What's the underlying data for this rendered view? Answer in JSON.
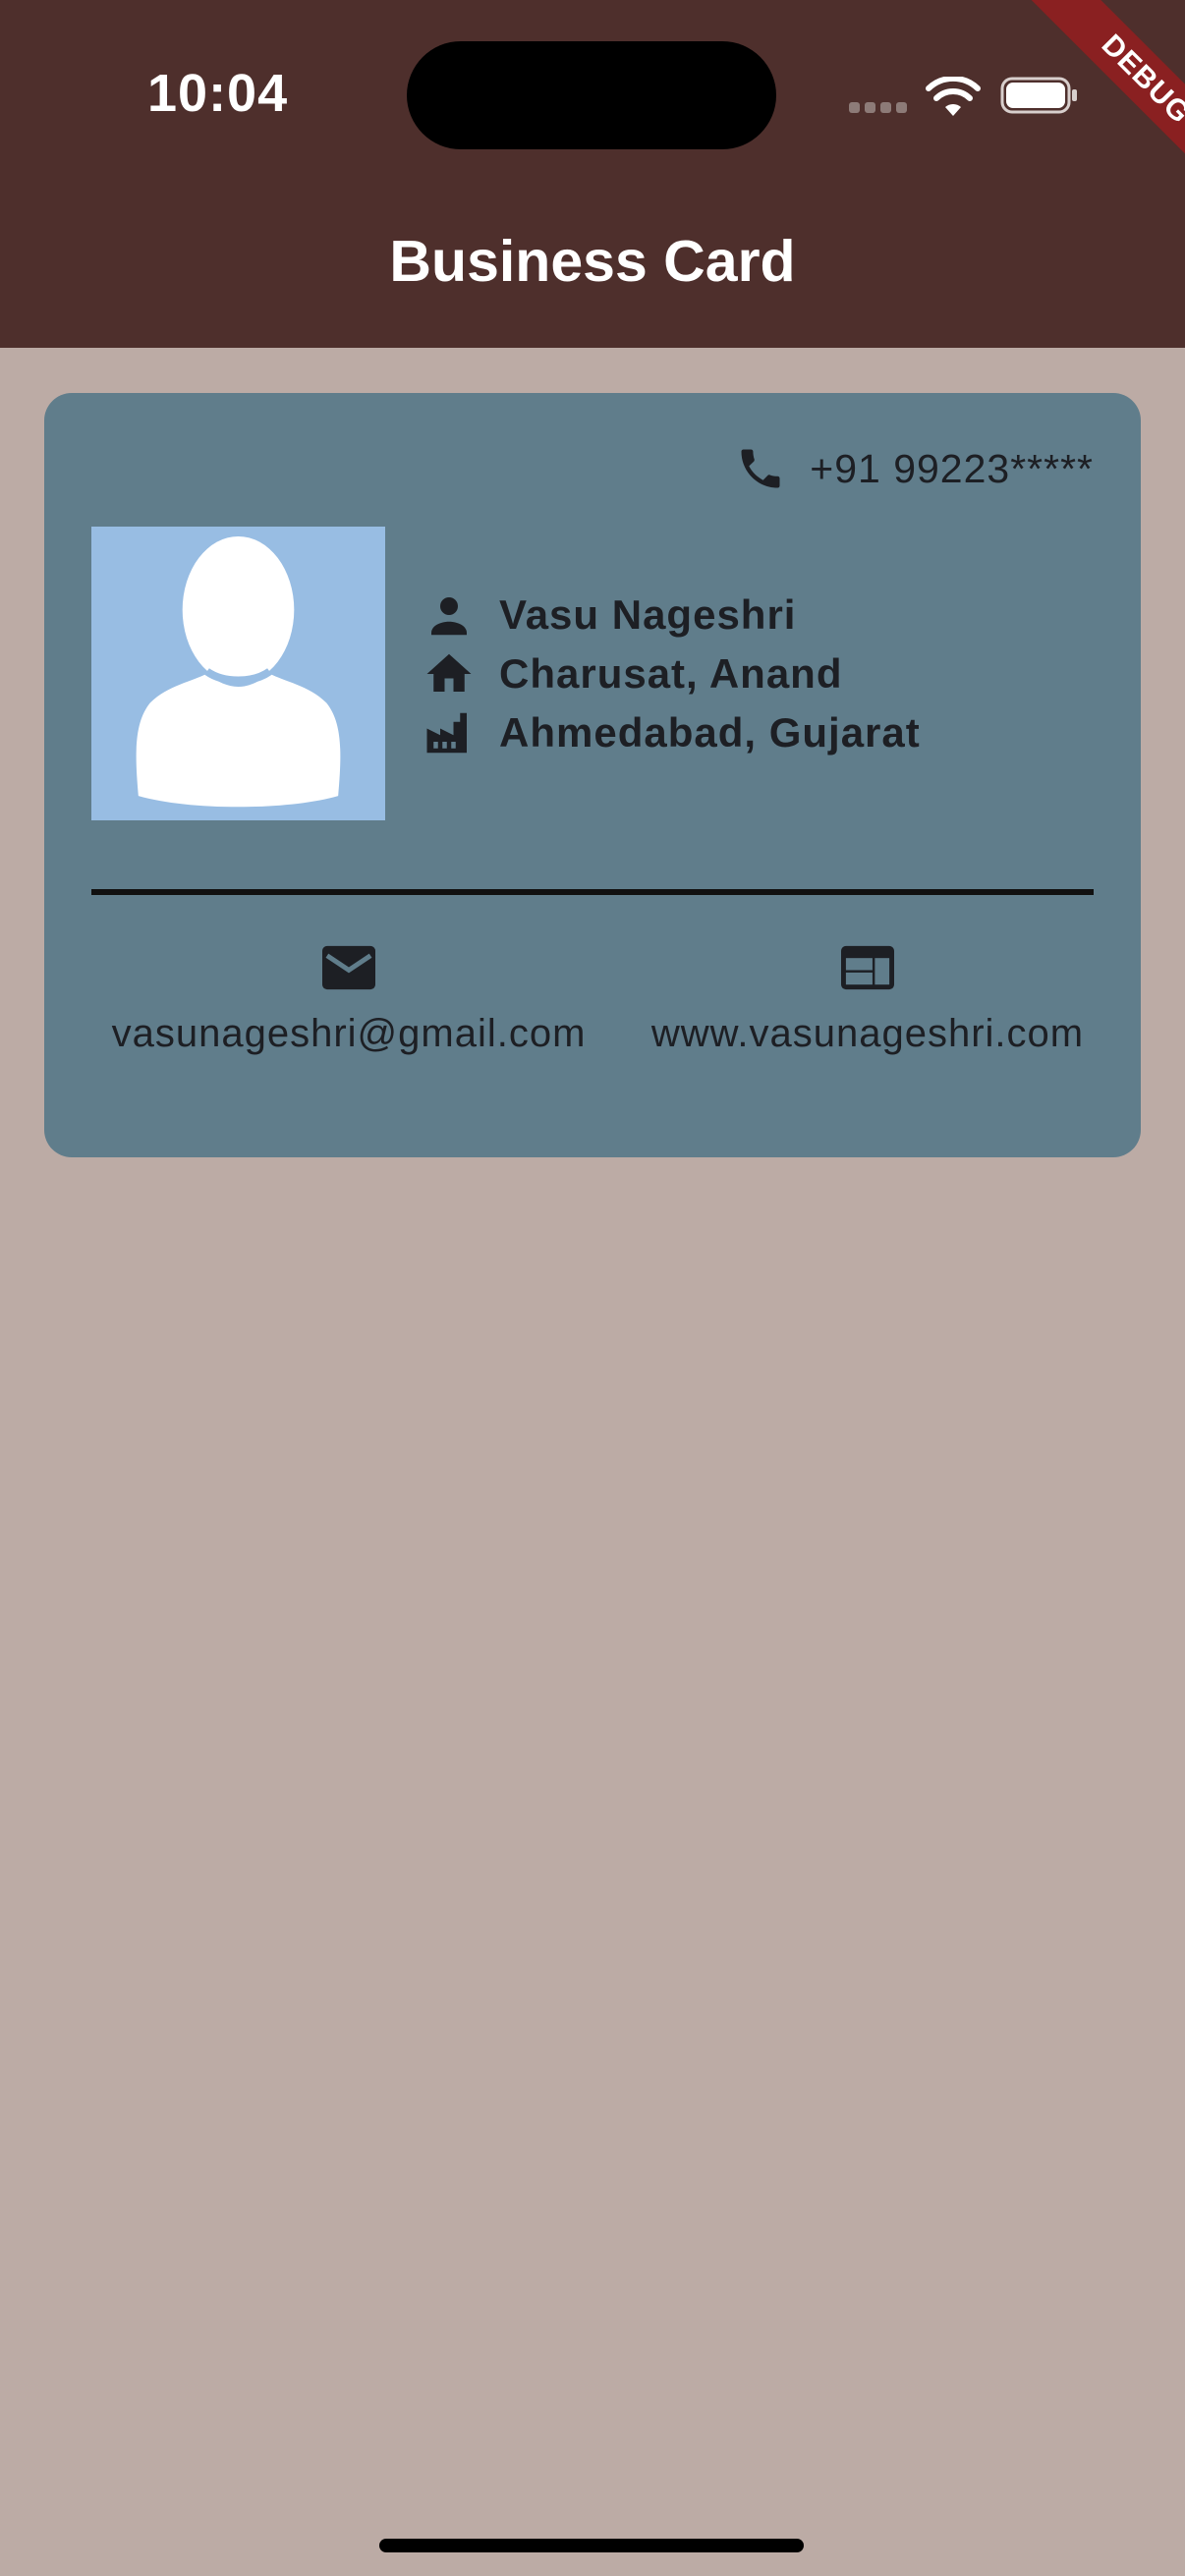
{
  "status_bar": {
    "time": "10:04"
  },
  "debug_banner": "DEBUG",
  "app_bar": {
    "title": "Business Card"
  },
  "card": {
    "phone": "+91 99223*****",
    "name": "Vasu Nageshri",
    "address": "Charusat, Anand",
    "location": "Ahmedabad, Gujarat",
    "email": "vasunageshri@gmail.com",
    "website": "www.vasunageshri.com"
  },
  "icons": {
    "phone": "phone-icon",
    "person": "person-icon",
    "home": "home-icon",
    "factory": "factory-icon",
    "email": "email-icon",
    "web": "web-icon",
    "avatar": "avatar-placeholder"
  },
  "colors": {
    "app_bar": "#4e2f2c",
    "background": "#bcaba5",
    "card": "#607d8b",
    "avatar_bg": "#98bde3",
    "debug": "#8a2021"
  }
}
